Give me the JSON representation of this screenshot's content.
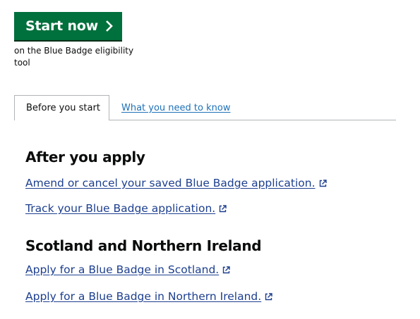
{
  "start": {
    "button_label": "Start now",
    "caption": "on the Blue Badge eligibility tool"
  },
  "tabs": [
    {
      "label": "Before you start",
      "selected": true
    },
    {
      "label": "What you need to know",
      "selected": false
    }
  ],
  "sections": {
    "after_apply": {
      "heading": "After you apply",
      "links": [
        "Amend or cancel your saved Blue Badge application.",
        "Track your Blue Badge application."
      ]
    },
    "scotland_ni": {
      "heading": "Scotland and Northern Ireland",
      "links": [
        "Apply for a Blue Badge in Scotland.",
        "Apply for a Blue Badge in Northern Ireland."
      ]
    }
  },
  "colors": {
    "button": "#00703c",
    "link": "#1d3f8f",
    "tab_link": "#1d70b8",
    "text": "#0b0c0c",
    "border": "#b1b4b6"
  },
  "icons": {
    "button": "chevron-right-icon",
    "links": "external-link-icon"
  }
}
